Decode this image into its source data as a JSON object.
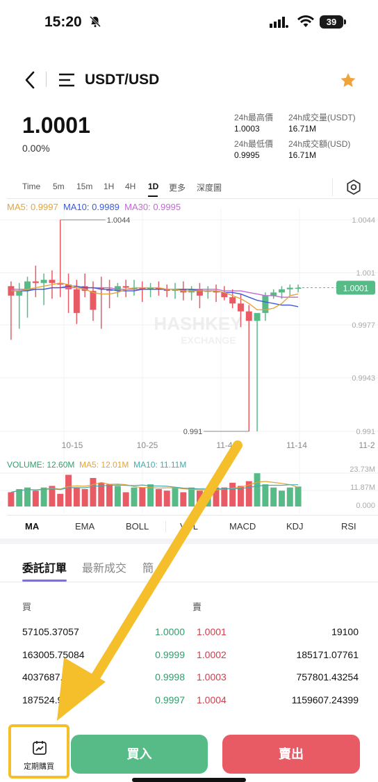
{
  "status": {
    "time": "15:20",
    "battery": "39"
  },
  "header": {
    "pair": "USDT/USD"
  },
  "ticker": {
    "price": "1.0001",
    "change": "0.00%",
    "stats": [
      {
        "label": "24h最高價",
        "value": "1.0003"
      },
      {
        "label": "24h成交量(USDT)",
        "value": "16.71M"
      },
      {
        "label": "24h最低價",
        "value": "0.9995"
      },
      {
        "label": "24h成交額(USD)",
        "value": "16.71M"
      }
    ]
  },
  "timeframes": [
    "Time",
    "5m",
    "15m",
    "1H",
    "4H",
    "1D",
    "更多",
    "深度圖"
  ],
  "active_timeframe": "1D",
  "ma_legend": {
    "ma5": "MA5: 0.9997",
    "ma10": "MA10: 0.9989",
    "ma30": "MA30: 0.9995"
  },
  "price_axis": [
    "1.0044",
    "1.001",
    "0.9977",
    "0.9943",
    "0.991"
  ],
  "current_price_tag": "1.0001",
  "high_marker": "1.0044",
  "low_marker": "0.991",
  "date_axis": [
    "10-15",
    "10-25",
    "11-4",
    "11-14",
    "11-2"
  ],
  "volume_legend": {
    "vol": "VOLUME: 12.60M",
    "ma5": "MA5: 12.01M",
    "ma10": "MA10: 11.11M"
  },
  "volume_axis": [
    "23.73M",
    "11.87M",
    "0.000"
  ],
  "watermark": {
    "line1": "HASHKEY",
    "line2": "EXCHANGE"
  },
  "indicators": [
    "MA",
    "EMA",
    "BOLL",
    "VOL",
    "MACD",
    "KDJ",
    "RSI"
  ],
  "tabs": [
    "委託訂單",
    "最新成交",
    "簡"
  ],
  "orderbook": {
    "buy_label": "買",
    "sell_label": "賣",
    "rows": [
      {
        "bid_qty": "57105.37057",
        "bid": "1.0000",
        "ask": "1.0001",
        "ask_qty": "19100"
      },
      {
        "bid_qty": "163005.75084",
        "bid": "0.9999",
        "ask": "1.0002",
        "ask_qty": "185171.07761"
      },
      {
        "bid_qty": "4037687.55",
        "bid": "0.9998",
        "ask": "1.0003",
        "ask_qty": "757801.43254"
      },
      {
        "bid_qty": "187524.95",
        "bid": "0.9997",
        "ask": "1.0004",
        "ask_qty": "1159607.24399"
      }
    ]
  },
  "actions": {
    "dca": "定期購買",
    "buy": "買入",
    "sell": "賣出"
  },
  "colors": {
    "up": "#56bb87",
    "down": "#e85a64",
    "ma5": "#e3a43a",
    "ma10": "#3b5bdb",
    "ma30": "#c06ad3",
    "highlight": "#f5bf2c",
    "accent": "#7c6df0"
  },
  "icons": [
    "bell-slash-icon",
    "signal-icon",
    "wifi-icon",
    "battery-icon",
    "back-icon",
    "menu-icon",
    "star-icon",
    "gear-icon",
    "calendar-chart-icon"
  ],
  "chart_data": {
    "type": "candlestick",
    "x": [
      "10-10",
      "10-11",
      "10-12",
      "10-13",
      "10-14",
      "10-15",
      "10-16",
      "10-17",
      "10-18",
      "10-19",
      "10-20",
      "10-21",
      "10-22",
      "10-23",
      "10-24",
      "10-25",
      "10-26",
      "10-27",
      "10-28",
      "10-29",
      "10-30",
      "10-31",
      "11-1",
      "11-2",
      "11-3",
      "11-4",
      "11-5",
      "11-6",
      "11-7",
      "11-8",
      "11-9",
      "11-10",
      "11-11",
      "11-12",
      "11-13",
      "11-14"
    ],
    "open": [
      1.0002,
      0.9996,
      0.9999,
      1.0005,
      1.0004,
      1.0006,
      1.0004,
      1.0003,
      1.0,
      1.0002,
      0.9999,
      1.0001,
      1.0,
      0.9999,
      1.0002,
      1.0001,
      1.0001,
      1.0,
      1.0001,
      1.0,
      0.9999,
      1.0,
      0.9998,
      1.0,
      0.9999,
      0.9999,
      0.9998,
      0.9995,
      0.9991,
      0.9986,
      0.998,
      0.9985,
      0.9996,
      0.9998,
      1.0,
      1.0001
    ],
    "high": [
      1.0005,
      1.0004,
      1.0008,
      1.0015,
      1.001,
      1.0012,
      1.0044,
      1.001,
      1.0006,
      1.001,
      1.0005,
      1.0008,
      1.0006,
      1.0004,
      1.0006,
      1.0006,
      1.0005,
      1.0004,
      1.0005,
      1.0003,
      1.0004,
      1.0005,
      1.0002,
      1.0004,
      1.0002,
      1.0003,
      1.0002,
      1.0,
      0.9997,
      0.999,
      0.9984,
      0.9998,
      1.0,
      1.0002,
      1.0003,
      1.0003
    ],
    "low": [
      0.9968,
      0.9975,
      0.9982,
      0.9995,
      0.999,
      0.9994,
      0.9995,
      0.9985,
      0.9978,
      0.9995,
      0.998,
      0.9975,
      0.9988,
      0.9995,
      0.9995,
      0.9996,
      0.9992,
      0.9995,
      0.9996,
      0.9995,
      0.9994,
      0.9993,
      0.9993,
      0.9988,
      0.9994,
      0.9992,
      0.9993,
      0.9988,
      0.9976,
      0.991,
      0.991,
      0.998,
      0.9994,
      0.9994,
      0.9996,
      0.9998
    ],
    "close": [
      0.9996,
      0.9999,
      1.0005,
      1.0004,
      1.0006,
      1.0004,
      1.0003,
      1.0,
      0.9985,
      0.9999,
      0.9987,
      1.0,
      0.9999,
      1.0002,
      1.0001,
      1.0001,
      1.0,
      1.0001,
      1.0,
      0.9999,
      1.0,
      0.9998,
      1.0,
      0.9996,
      0.9999,
      0.9998,
      0.9995,
      0.9991,
      0.9986,
      0.998,
      0.9985,
      0.9996,
      0.9998,
      1.0,
      1.0001,
      1.0001
    ],
    "volume": [
      9,
      11,
      12,
      10,
      12,
      13,
      8,
      20,
      12,
      11,
      18,
      15,
      14,
      13,
      9,
      12,
      12,
      14,
      11,
      10,
      12,
      9,
      12,
      10,
      9,
      12,
      12,
      15,
      13,
      16,
      21,
      14,
      12,
      10,
      12,
      12.6
    ],
    "ma5": [
      0.9999,
      0.9999,
      1.0,
      1.0001,
      1.0002,
      1.0003,
      1.0004,
      1.0003,
      1.0001,
      1.0,
      0.9998,
      0.9997,
      0.9997,
      0.9998,
      1.0,
      1.0001,
      1.0001,
      1.0001,
      1.0001,
      1.0,
      1.0,
      0.9999,
      0.9999,
      0.9999,
      0.9999,
      0.9999,
      0.9998,
      0.9996,
      0.9994,
      0.9991,
      0.9987,
      0.9987,
      0.9988,
      0.9991,
      0.9996,
      0.9997
    ],
    "ma10": [
      0.9999,
      0.9999,
      0.9999,
      1.0,
      1.0,
      1.0001,
      1.0001,
      1.0002,
      1.0002,
      1.0001,
      1.0001,
      1.0,
      1.0,
      0.9999,
      0.9999,
      0.9999,
      1.0,
      1.0,
      1.0,
      1.0,
      1.0,
      1.0,
      1.0,
      0.9999,
      0.9999,
      0.9999,
      0.9998,
      0.9998,
      0.9997,
      0.9995,
      0.9993,
      0.9992,
      0.9991,
      0.999,
      0.999,
      0.9989
    ],
    "ma30": [
      1.0,
      1.0,
      1.0,
      1.0,
      1.0,
      1.0001,
      1.0001,
      1.0001,
      1.0001,
      1.0001,
      1.0001,
      1.0001,
      1.0001,
      1.0,
      1.0,
      1.0,
      1.0,
      1.0,
      1.0,
      1.0,
      1.0,
      1.0,
      1.0,
      1.0,
      1.0,
      1.0,
      0.9999,
      0.9999,
      0.9999,
      0.9998,
      0.9997,
      0.9996,
      0.9996,
      0.9995,
      0.9995,
      0.9995
    ],
    "ylim": [
      0.991,
      1.0044
    ],
    "volume_ylim": [
      0,
      23.73
    ]
  }
}
